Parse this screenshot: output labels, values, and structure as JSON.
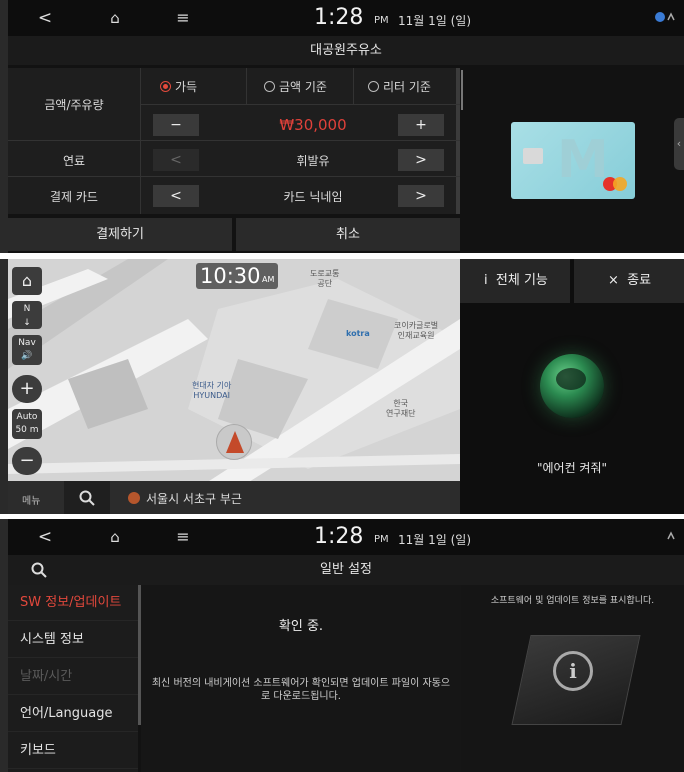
{
  "status_bar": {
    "back": "<",
    "home": "⌂",
    "menu": "≡",
    "time": "1:28",
    "ampm": "PM",
    "date": "11월  1일 (일)"
  },
  "fuel_panel": {
    "title": "대공원주유소",
    "labels": {
      "amount": "금액/주유량",
      "fuel": "연료",
      "card": "결제 카드"
    },
    "options": [
      {
        "label": "가득",
        "selected": true
      },
      {
        "label": "금액 기준",
        "selected": false
      },
      {
        "label": "리터 기준",
        "selected": false
      }
    ],
    "minus": "−",
    "plus": "+",
    "amount_value": "₩30,000",
    "fuel_value": "휘발유",
    "card_value": "카드 닉네임",
    "prev": "<",
    "next": ">",
    "pay_button": "결제하기",
    "cancel_button": "취소",
    "card_brand_text": "M"
  },
  "map_panel": {
    "clock_time": "10:30",
    "clock_ampm": "AM",
    "controls": {
      "home": "⌂",
      "north": "N",
      "nav": "Nav",
      "zoom_in": "+",
      "auto": "Auto",
      "auto_scale": "50 m",
      "zoom_out": "−"
    },
    "pois": [
      "도로교통\n공단",
      "현대자 기아\nHYUNDAI",
      "kotra",
      "코이카글로벌\n인재교육원",
      "한국\n연구재단"
    ],
    "bottom": {
      "menu": "메뉴",
      "search_icon": "🔍",
      "location": "서울시 서초구 부근"
    }
  },
  "voice_panel": {
    "all_functions": "전체 기능",
    "all_functions_icon": "i",
    "close": "종료",
    "close_icon": "×",
    "command": "\"에어컨 켜줘\""
  },
  "settings_panel": {
    "title": "일반 설정",
    "search_icon": "🔍",
    "menu": [
      {
        "label": "SW 정보/업데이트",
        "state": "active"
      },
      {
        "label": "시스템 정보",
        "state": "normal"
      },
      {
        "label": "날짜/시간",
        "state": "disabled"
      },
      {
        "label": "언어/Language",
        "state": "normal"
      },
      {
        "label": "키보드",
        "state": "normal"
      }
    ],
    "checking": "확인 중.",
    "description": "최신 버전의 내비게이션 소프트웨어가 확인되면 업데이트 파일이 자동으로 다운로드됩니다.",
    "info_description": "소프트웨어 및 업데이트 정보를 표시합니다.",
    "info_icon": "i"
  },
  "colors": {
    "accent": "#e2483c",
    "amount": "#e0413a",
    "background": "#121212"
  }
}
